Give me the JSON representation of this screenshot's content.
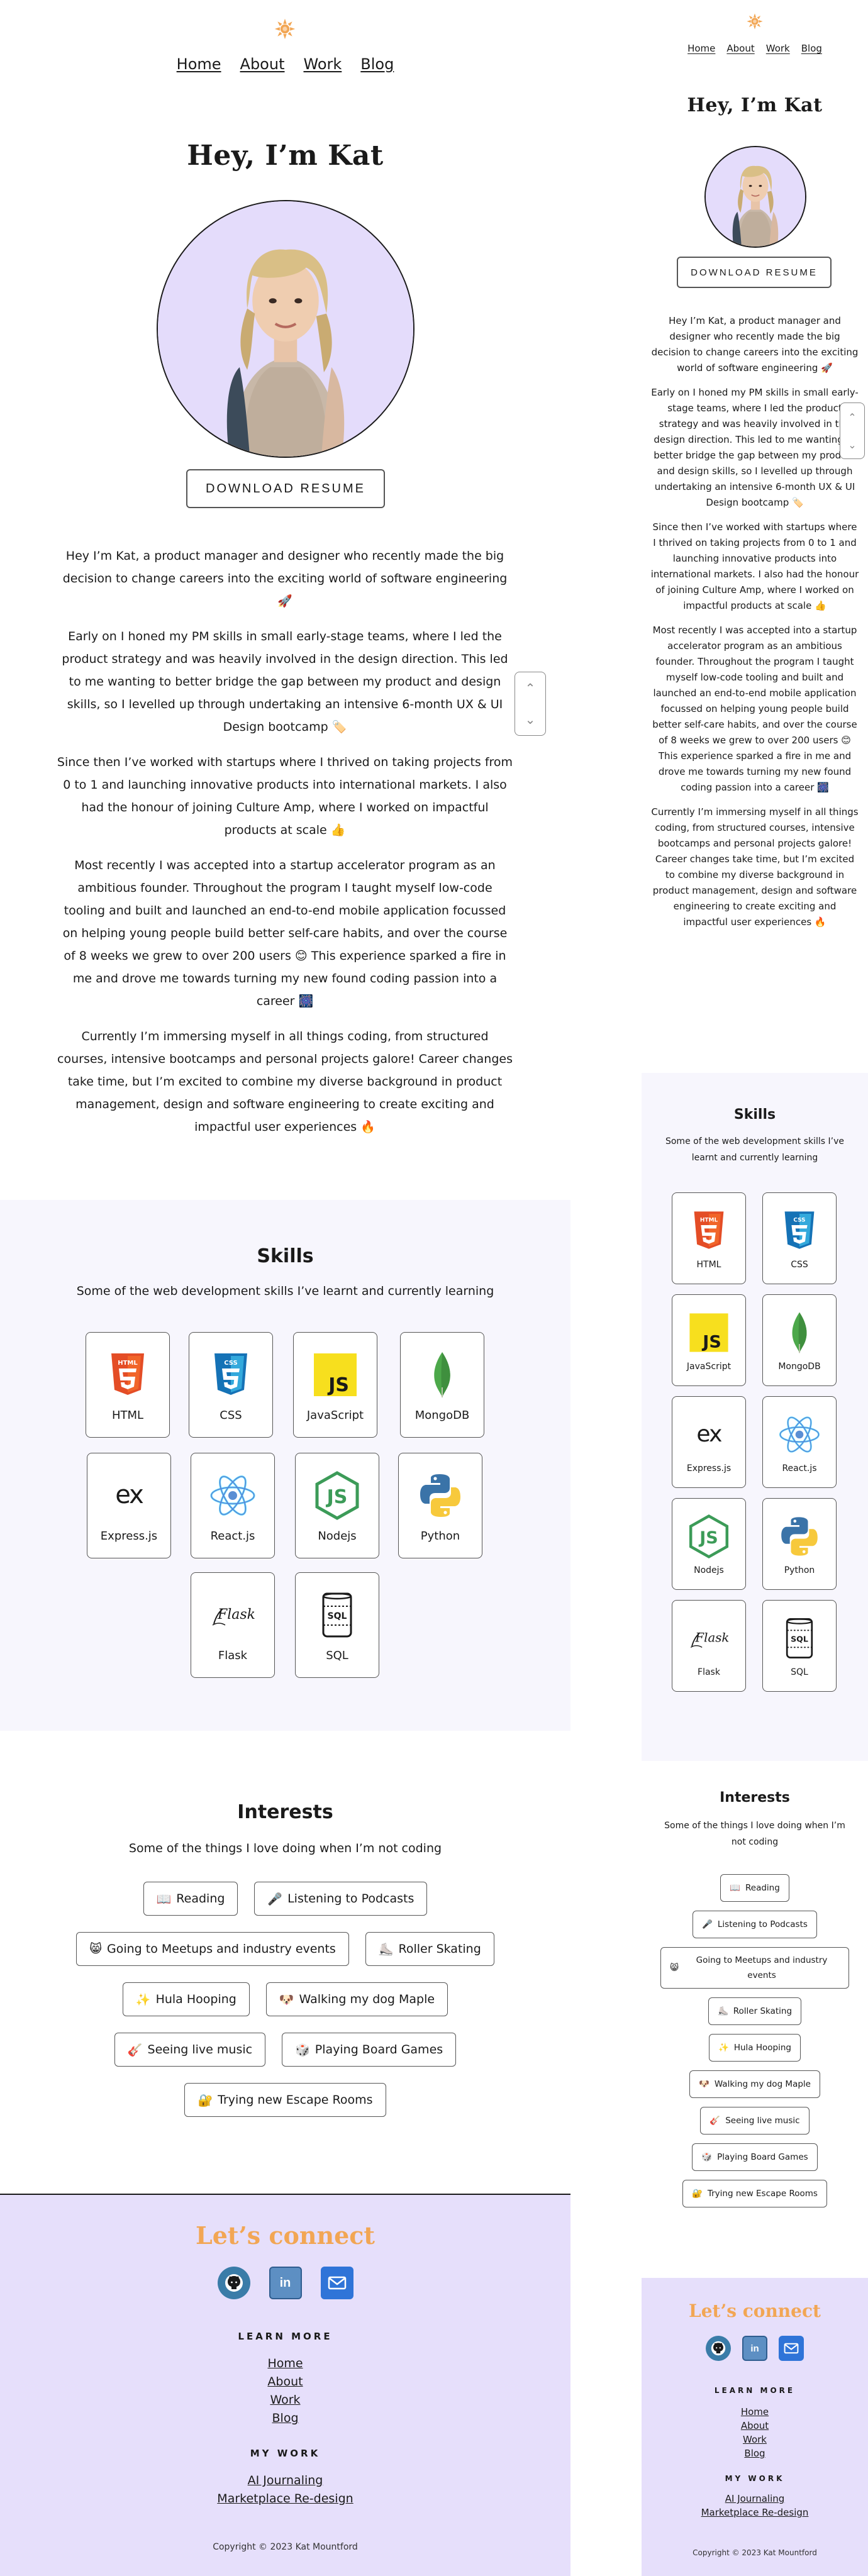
{
  "nav": [
    "Home",
    "About",
    "Work",
    "Blog"
  ],
  "hero": {
    "title": "Hey, I’m Kat",
    "download_button": "DOWNLOAD RESUME"
  },
  "bio": [
    "Hey I’m Kat, a product manager and designer who recently made the big decision to change careers into the exciting world of software engineering 🚀",
    "Early on I honed my PM skills in small early-stage teams, where I led the product strategy and was heavily involved in the design direction. This led to me wanting to better bridge the gap between my product and design skills, so I levelled up through undertaking an intensive 6-month UX & UI Design bootcamp 🏷️",
    "Since then I’ve worked with startups where I thrived on taking projects from 0 to 1 and launching innovative products into international markets. I also had the honour of joining Culture Amp, where I worked on impactful products at scale 👍",
    "Most recently I was accepted into a startup accelerator program as an ambitious founder. Throughout the program I taught myself low-code tooling and built and launched an end-to-end mobile application focussed on helping young people build better self-care habits, and over the course of 8 weeks we grew to over 200 users 😊 This experience sparked a fire in me and drove me towards turning my new found coding passion into a career 🎆",
    "Currently I’m immersing myself in all things coding, from structured courses, intensive bootcamps and personal projects galore! Career changes take time, but I’m excited to combine my diverse background in product management, design and software engineering to create exciting and impactful user experiences 🔥"
  ],
  "skills": {
    "title": "Skills",
    "subtitle": "Some of the web development skills I’ve learnt and currently learning",
    "items": [
      {
        "label": "HTML",
        "icon": "html5-icon"
      },
      {
        "label": "CSS",
        "icon": "css3-icon"
      },
      {
        "label": "JavaScript",
        "icon": "javascript-icon"
      },
      {
        "label": "MongoDB",
        "icon": "mongodb-icon"
      },
      {
        "label": "Express.js",
        "icon": "express-icon"
      },
      {
        "label": "React.js",
        "icon": "react-icon"
      },
      {
        "label": "Nodejs",
        "icon": "nodejs-icon"
      },
      {
        "label": "Python",
        "icon": "python-icon"
      },
      {
        "label": "Flask",
        "icon": "flask-icon"
      },
      {
        "label": "SQL",
        "icon": "sql-icon"
      }
    ]
  },
  "interests": {
    "title": "Interests",
    "subtitle": "Some of the things I love doing when I’m not coding",
    "items": [
      {
        "emoji": "📖",
        "label": "Reading"
      },
      {
        "emoji": "🎤",
        "label": "Listening to Podcasts"
      },
      {
        "emoji": "😸",
        "label": "Going to Meetups and industry events"
      },
      {
        "emoji": "⛸️",
        "label": "Roller Skating"
      },
      {
        "emoji": "✨",
        "label": "Hula Hooping"
      },
      {
        "emoji": "🐶",
        "label": "Walking my dog Maple"
      },
      {
        "emoji": "🎸",
        "label": "Seeing live music"
      },
      {
        "emoji": "🎲",
        "label": "Playing Board Games"
      },
      {
        "emoji": "🔐",
        "label": "Trying new Escape Rooms"
      }
    ]
  },
  "footer": {
    "title": "Let’s connect",
    "social": [
      "github-icon",
      "linkedin-icon",
      "mail-icon"
    ],
    "linkedin_text": "in",
    "learn_more_heading": "LEARN MORE",
    "learn_more_links": [
      "Home",
      "About",
      "Work",
      "Blog"
    ],
    "my_work_heading": "MY WORK",
    "my_work_links": [
      "AI Journaling",
      "Marketplace Re-design"
    ],
    "copyright": "Copyright © 2023 Kat Mountford"
  },
  "colors": {
    "accent_orange": "#f2a654",
    "lavender": "#e6dffb",
    "portrait_bg": "#e4dcfb",
    "skills_bg": "#f7f6fd"
  }
}
